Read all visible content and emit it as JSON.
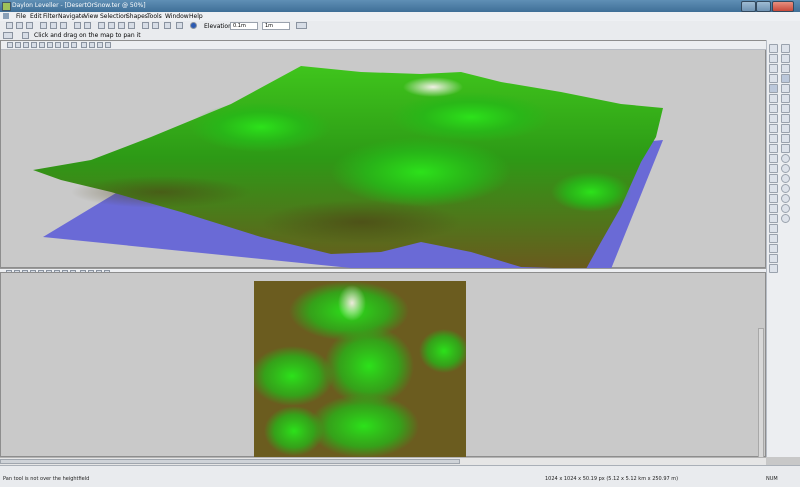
{
  "window": {
    "title": "Daylon Leveller - [DesertOrSnow.ter @ 50%]"
  },
  "menu": [
    "File",
    "Edit",
    "Filter",
    "Navigate",
    "View",
    "Selection",
    "Shapes",
    "Tools",
    "Window",
    "Help"
  ],
  "toolbar": {
    "elevations_label": "Elevations:",
    "elev_low": "0.1m",
    "elev_high": "1m"
  },
  "hint": {
    "text": "Click and drag on the map to pan it"
  },
  "status": {
    "left": "Pan tool is not over the heightfield",
    "dims": "1024 x 1024 x 50.19 px (5.12 x 5.12 km x 250.97 m)",
    "num": "NUM"
  },
  "colors": {
    "water": "#6a6ad6",
    "terrain_low": "#6a5a1e",
    "terrain_mid": "#2aa81a",
    "terrain_high": "#2ce21a",
    "snow": "#e8e6dc"
  }
}
